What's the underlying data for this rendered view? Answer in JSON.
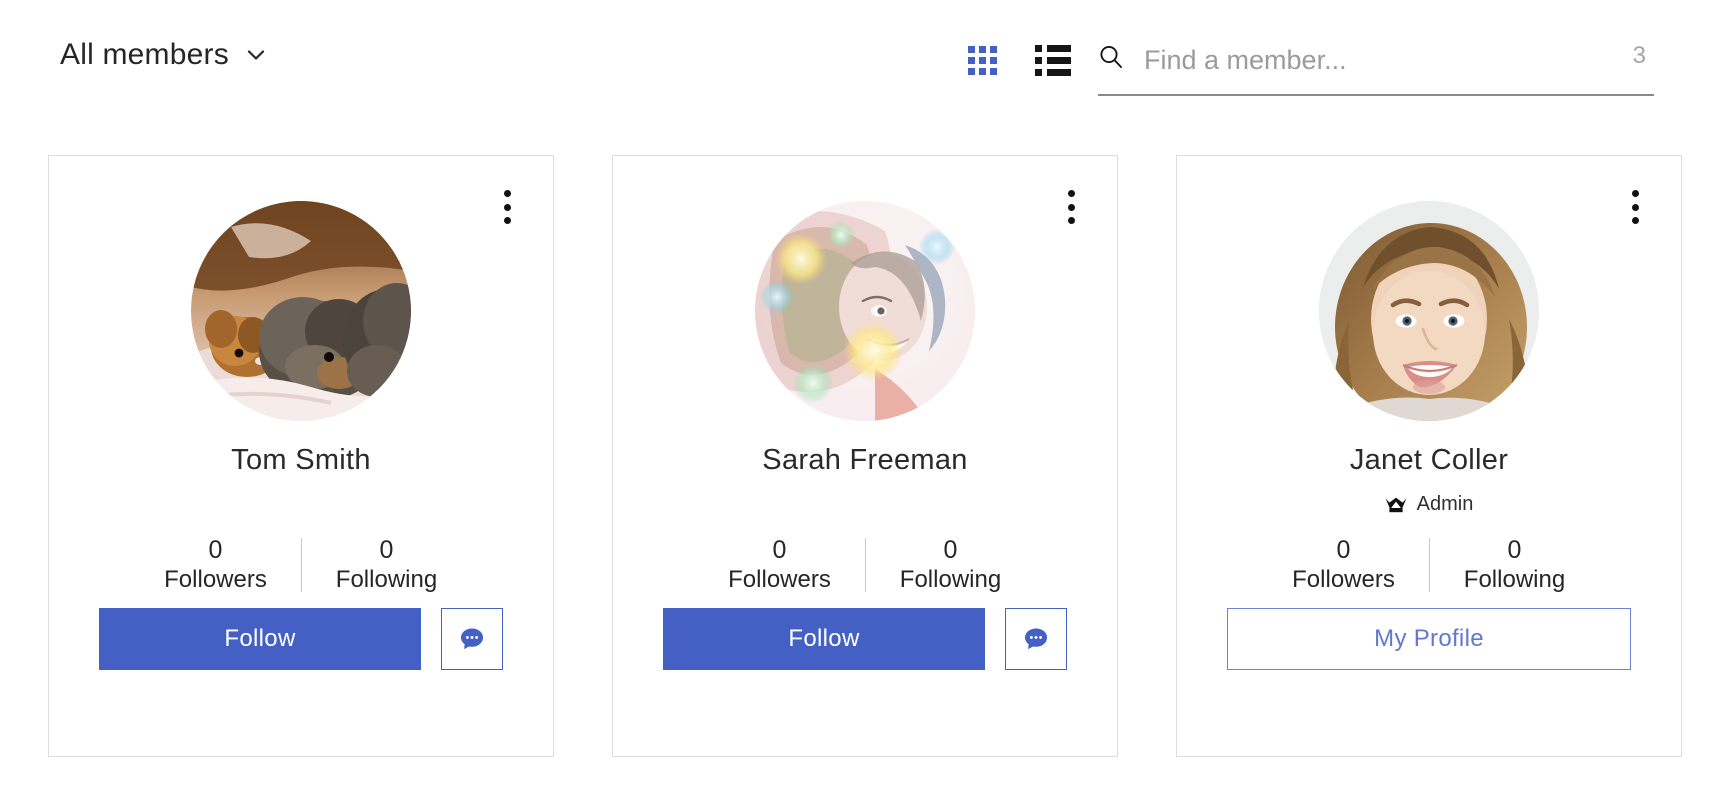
{
  "header": {
    "filter": {
      "label": "All members",
      "chevron_icon": "chevron-down-icon"
    },
    "view_toggles": {
      "grid_label": "grid-view-icon",
      "list_label": "list-view-icon",
      "active": "grid",
      "active_color": "#4460c5",
      "inactive_color": "#151515"
    },
    "search": {
      "icon": "search-icon",
      "placeholder": "Find a member...",
      "value": ""
    },
    "result_count": "3"
  },
  "theme": {
    "accent": "#4460c5",
    "profile_outline": "#6b82d6",
    "card_border": "#dcdcdc",
    "text": "#262626",
    "muted": "#9b9b9b"
  },
  "labels": {
    "followers": "Followers",
    "following": "Following",
    "follow": "Follow",
    "my_profile": "My Profile",
    "message_icon": "message-bubble-icon",
    "kebab_icon": "more-options-icon",
    "crown_icon": "crown-icon"
  },
  "members": [
    {
      "name": "Tom Smith",
      "role": null,
      "avatar_alt": "photo of sleeping puppies on a bed",
      "followers": "0",
      "following": "0",
      "primary_action": "Follow",
      "has_message_button": true
    },
    {
      "name": "Sarah Freeman",
      "role": null,
      "avatar_alt": "photo of smiling woman with colorful bokeh lights",
      "followers": "0",
      "following": "0",
      "primary_action": "Follow",
      "has_message_button": true
    },
    {
      "name": "Janet Coller",
      "role": "Admin",
      "avatar_alt": "photo of smiling blonde woman",
      "followers": "0",
      "following": "0",
      "primary_action": "My Profile",
      "has_message_button": false
    }
  ]
}
